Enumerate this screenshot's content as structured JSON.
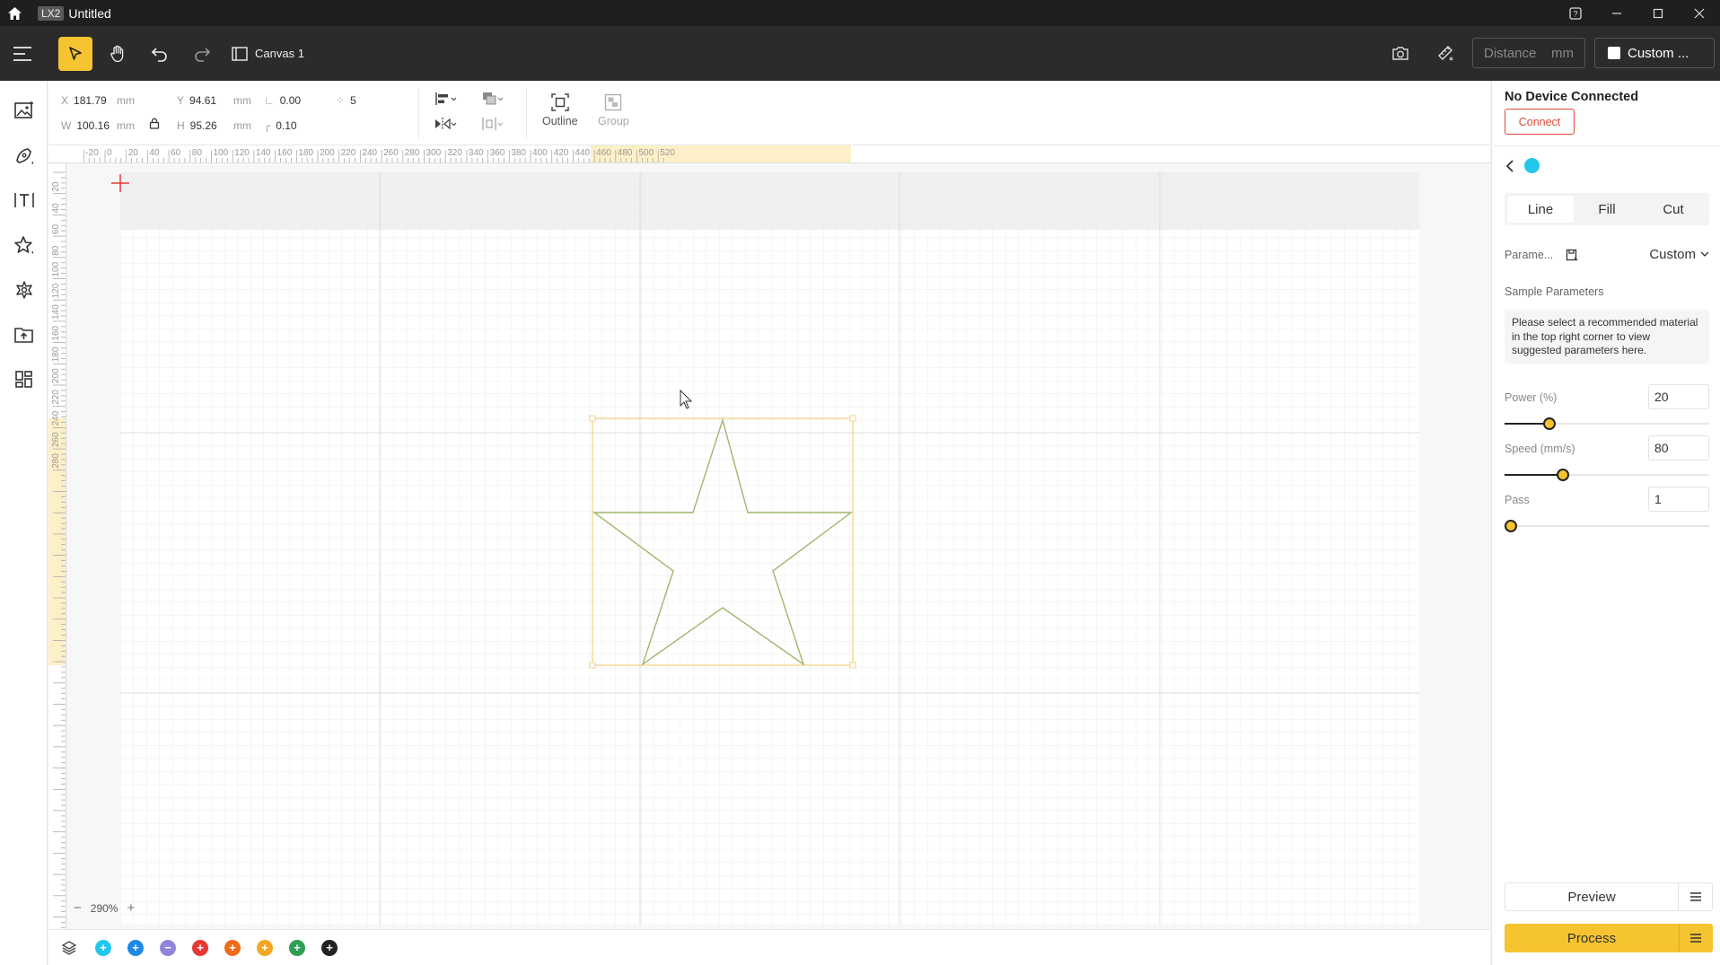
{
  "titlebar": {
    "badge": "LX2",
    "title": "Untitled"
  },
  "toolbar": {
    "canvas_label": "Canvas 1",
    "distance_placeholder": "Distance",
    "distance_unit": "mm",
    "material_label": "Custom ..."
  },
  "props": {
    "x_label": "X",
    "x_value": "181.79",
    "x_unit": "mm",
    "y_label": "Y",
    "y_value": "94.61",
    "y_unit": "mm",
    "angle_value": "0.00",
    "points_value": "5",
    "w_label": "W",
    "w_value": "100.16",
    "w_unit": "mm",
    "h_label": "H",
    "h_value": "95.26",
    "h_unit": "mm",
    "radius_value": "0.10",
    "outline_label": "Outline",
    "group_label": "Group"
  },
  "ruler": {
    "h_ticks": [
      "-20",
      "0",
      "20",
      "40",
      "60",
      "80",
      "100",
      "120",
      "140",
      "160",
      "180",
      "200",
      "220",
      "240",
      "260",
      "280",
      "300",
      "320",
      "340",
      "360",
      "380",
      "400",
      "420",
      "440",
      "460",
      "480",
      "500",
      "520"
    ],
    "v_ticks": [
      "20",
      "40",
      "60",
      "80",
      "100",
      "120",
      "140",
      "160",
      "180",
      "200",
      "220",
      "240",
      "260",
      "280"
    ]
  },
  "zoom": {
    "value": "290%",
    "minus": "−",
    "plus": "+"
  },
  "layers": [
    {
      "color": "#22c7ea",
      "symbol": "+"
    },
    {
      "color": "#1e88e5",
      "symbol": "+"
    },
    {
      "color": "#8f86d9",
      "symbol": "−"
    },
    {
      "color": "#e53935",
      "symbol": "+"
    },
    {
      "color": "#ef6c1a",
      "symbol": "+"
    },
    {
      "color": "#f5a623",
      "symbol": "+"
    },
    {
      "color": "#2e9e55",
      "symbol": "+"
    },
    {
      "color": "#222222",
      "symbol": "+"
    }
  ],
  "panel": {
    "status": "No Device Connected",
    "connect_label": "Connect",
    "tabs": [
      "Line",
      "Fill",
      "Cut"
    ],
    "params_label": "Parame...",
    "params_value": "Custom",
    "sample_label": "Sample Parameters",
    "hint": "Please select a recommended material in the top right corner to view suggested parameters here.",
    "power_label": "Power  (%)",
    "power_value": "20",
    "power_level": 0.2,
    "speed_label": "Speed  (mm/s)",
    "speed_value": "80",
    "speed_level": 0.27,
    "pass_label": "Pass",
    "pass_value": "1",
    "pass_level": 0.0,
    "preview_label": "Preview",
    "process_label": "Process"
  },
  "colors": {
    "accent": "#f6c331",
    "danger": "#e04a3a",
    "layer_active": "#22c7ea",
    "shape_stroke": "#9db86a",
    "selection": "#f3d48a"
  }
}
